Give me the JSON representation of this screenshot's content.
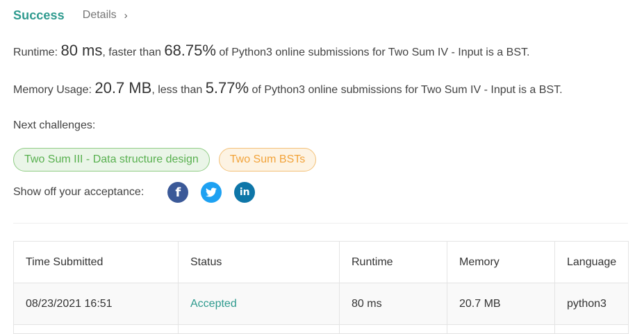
{
  "header": {
    "success": "Success",
    "details": "Details",
    "chevron": "›"
  },
  "runtime": {
    "label": "Runtime: ",
    "value": "80 ms",
    "faster": ", faster than ",
    "percent": "68.75%",
    "suffix": " of Python3 online submissions for Two Sum IV - Input is a BST."
  },
  "memory": {
    "label": "Memory Usage: ",
    "value": "20.7 MB",
    "less": ", less than ",
    "percent": "5.77%",
    "suffix": " of Python3 online submissions for Two Sum IV - Input is a BST."
  },
  "next": {
    "label": "Next challenges:",
    "chips": [
      {
        "label": "Two Sum III - Data structure design",
        "color": "green"
      },
      {
        "label": "Two Sum BSTs",
        "color": "orange"
      }
    ]
  },
  "share": {
    "label": "Show off your acceptance:",
    "icons": [
      {
        "icon": "facebook-icon",
        "glyph": "f",
        "color": "#3b5998"
      },
      {
        "icon": "twitter-icon",
        "glyph": "🐦",
        "color": "#1da1f2"
      },
      {
        "icon": "linkedin-icon",
        "glyph": "in",
        "color": "#0e76a8"
      }
    ]
  },
  "table": {
    "columns": [
      "Time Submitted",
      "Status",
      "Runtime",
      "Memory",
      "Language"
    ],
    "rows": [
      {
        "time": "08/23/2021 16:51",
        "status": "Accepted",
        "runtime": "80 ms",
        "memory": "20.7 MB",
        "language": "python3"
      }
    ]
  }
}
